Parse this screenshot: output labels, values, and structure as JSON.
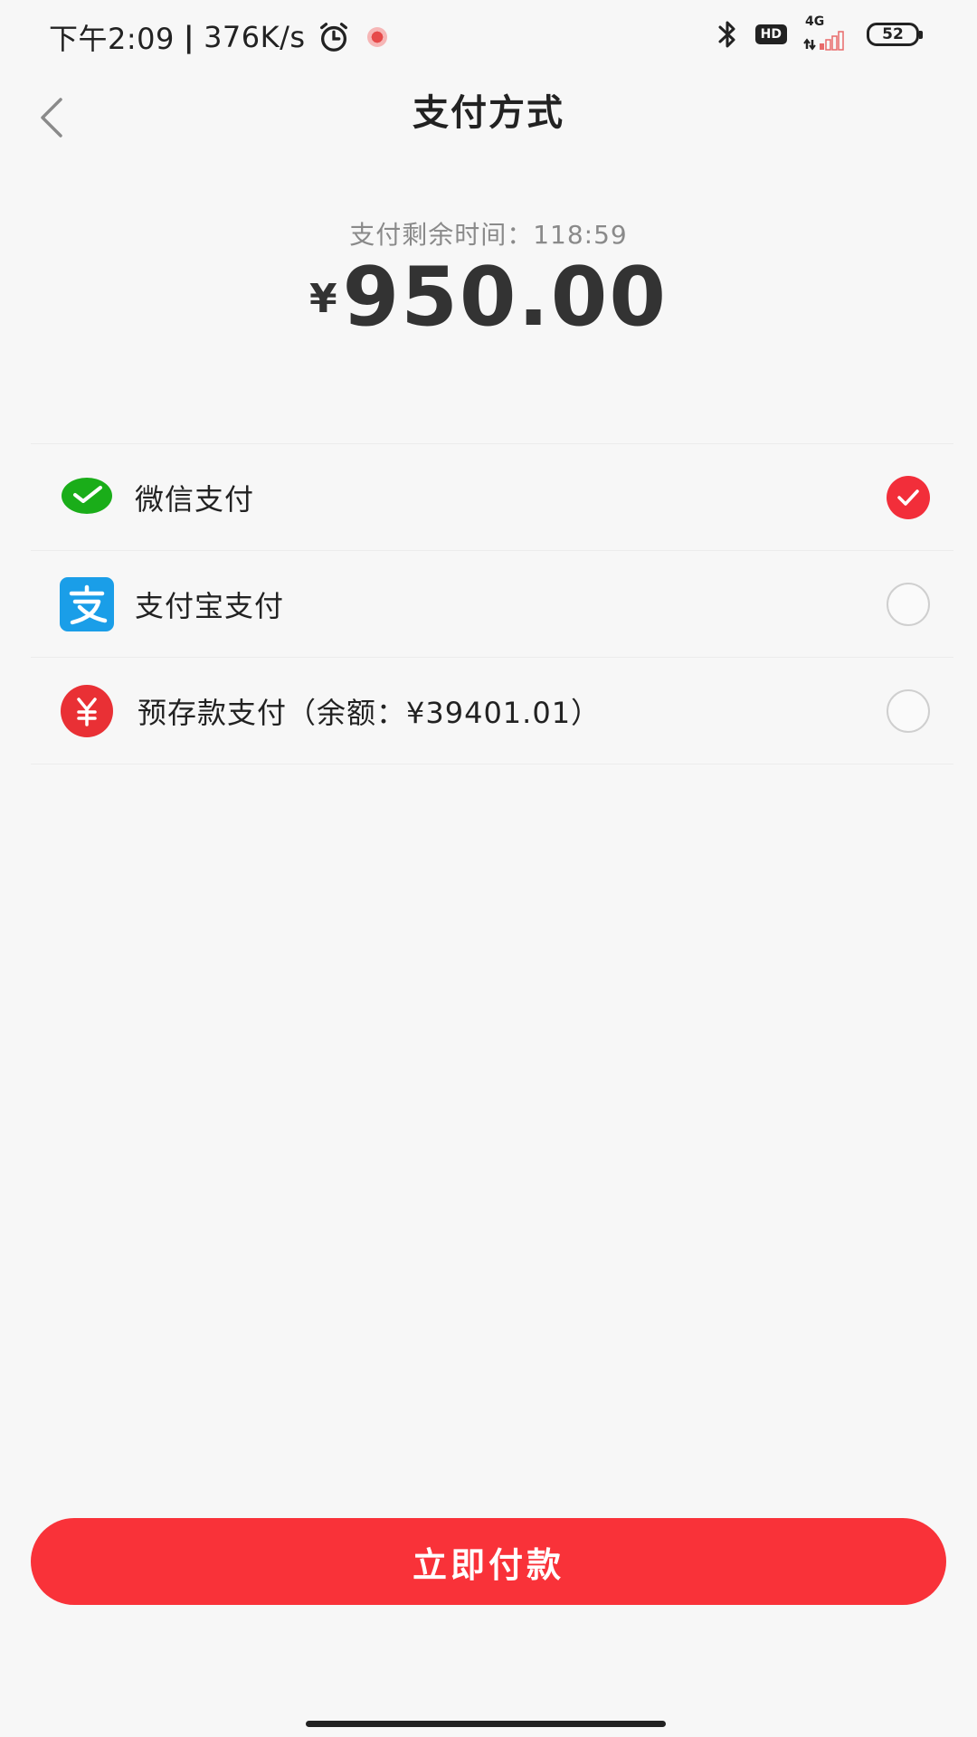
{
  "status_bar": {
    "time": "下午2:09",
    "separator": "|",
    "net_speed": "376K/s",
    "hd_label": "HD",
    "network_label": "4G",
    "battery_level": "52"
  },
  "header": {
    "title": "支付方式"
  },
  "payment": {
    "countdown_label": "支付剩余时间：118:59",
    "currency_symbol": "¥",
    "amount": "950.00"
  },
  "methods": [
    {
      "label": "微信支付",
      "icon": "wechat-pay-icon",
      "selected": true
    },
    {
      "label": "支付宝支付",
      "icon": "alipay-icon",
      "selected": false
    },
    {
      "label": "预存款支付（余额：¥39401.01）",
      "icon": "prepaid-yuan-icon",
      "selected": false
    }
  ],
  "actions": {
    "pay_now_label": "立即付款"
  },
  "colors": {
    "accent": "#f93239",
    "wechat_green": "#1aad19",
    "alipay_blue": "#1a9ee8",
    "prepaid_red": "#e93035"
  }
}
